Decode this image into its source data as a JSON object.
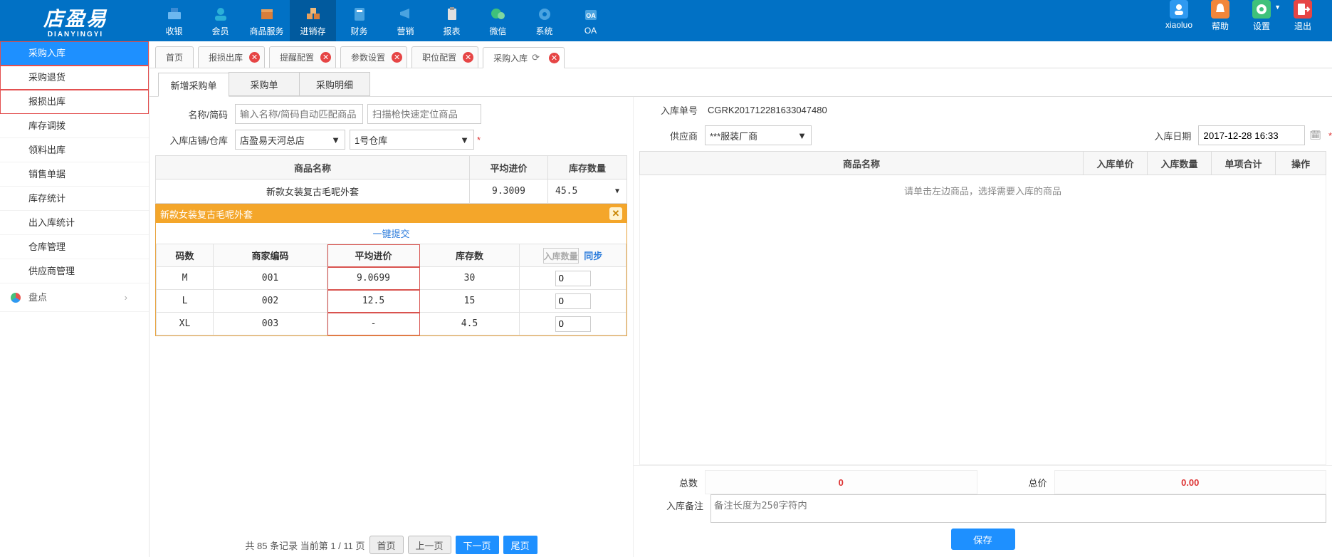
{
  "logo": {
    "main": "店盈易",
    "sub": "DIANYINGYI"
  },
  "topnav": {
    "items": [
      {
        "label": "收银",
        "icon": "cash-register"
      },
      {
        "label": "会员",
        "icon": "users"
      },
      {
        "label": "商品服务",
        "icon": "gift"
      },
      {
        "label": "进销存",
        "icon": "boxes",
        "active": true
      },
      {
        "label": "财务",
        "icon": "finance"
      },
      {
        "label": "营销",
        "icon": "megaphone"
      },
      {
        "label": "报表",
        "icon": "clipboard"
      },
      {
        "label": "微信",
        "icon": "wechat"
      },
      {
        "label": "系统",
        "icon": "gear"
      },
      {
        "label": "OA",
        "icon": "oa"
      }
    ],
    "right": [
      {
        "label": "xiaoluo",
        "icon": "user",
        "color": "#2f99f0"
      },
      {
        "label": "帮助",
        "icon": "bell",
        "color": "#f2863a"
      },
      {
        "label": "设置",
        "icon": "setting",
        "color": "#3fc17b",
        "arrow": true
      },
      {
        "label": "退出",
        "icon": "exit",
        "color": "#e64545"
      }
    ]
  },
  "sidebar": {
    "items": [
      {
        "label": "采购入库",
        "selected": true,
        "marked": true
      },
      {
        "label": "采购退货",
        "marked": true
      },
      {
        "label": "报损出库",
        "marked": true
      },
      {
        "label": "库存调拨"
      },
      {
        "label": "领料出库"
      },
      {
        "label": "销售单据"
      },
      {
        "label": "库存统计"
      },
      {
        "label": "出入库统计"
      },
      {
        "label": "仓库管理"
      },
      {
        "label": "供应商管理"
      }
    ],
    "section": {
      "label": "盘点",
      "caret": "›"
    }
  },
  "tabs": [
    {
      "label": "首页"
    },
    {
      "label": "报损出库",
      "closable": true
    },
    {
      "label": "提醒配置",
      "closable": true
    },
    {
      "label": "参数设置",
      "closable": true
    },
    {
      "label": "职位配置",
      "closable": true
    },
    {
      "label": "采购入库",
      "closable": true,
      "refresh": true,
      "active": true
    }
  ],
  "subtabs": [
    {
      "label": "新增采购单",
      "active": true
    },
    {
      "label": "采购单"
    },
    {
      "label": "采购明细"
    }
  ],
  "leftForm": {
    "name_label": "名称/简码",
    "name_placeholder": "输入名称/简码自动匹配商品",
    "scan_placeholder": "扫描枪快速定位商品",
    "shop_label": "入库店铺/仓库",
    "shop_value": "店盈易天河总店",
    "warehouse_value": "1号仓库"
  },
  "leftGrid": {
    "headers": {
      "name": "商品名称",
      "price": "平均进价",
      "qty": "库存数量"
    },
    "row": {
      "name": "新款女装复古毛呢外套",
      "price": "9.3009",
      "qty": "45.5"
    }
  },
  "popup": {
    "title": "新款女装复古毛呢外套",
    "quick_submit": "一键提交",
    "headers": {
      "size": "码数",
      "sku": "商家编码",
      "price": "平均进价",
      "stock": "库存数",
      "enter": "入库数量",
      "sync": "同步"
    },
    "rows": [
      {
        "size": "M",
        "sku": "001",
        "price": "9.0699",
        "stock": "30",
        "enter": "0"
      },
      {
        "size": "L",
        "sku": "002",
        "price": "12.5",
        "stock": "15",
        "enter": "0"
      },
      {
        "size": "XL",
        "sku": "003",
        "price": "-",
        "stock": "4.5",
        "enter": "0"
      }
    ]
  },
  "pager": {
    "summary": "共 85 条记录 当前第 1 / 11 页",
    "first": "首页",
    "prev": "上一页",
    "next": "下一页",
    "last": "尾页"
  },
  "rightForm": {
    "order_label": "入库单号",
    "order_value": "CGRK201712281633047480",
    "supplier_label": "供应商",
    "supplier_value": "***服装厂商",
    "date_label": "入库日期",
    "date_value": "2017-12-28 16:33"
  },
  "rightGrid": {
    "headers": {
      "name": "商品名称",
      "price": "入库单价",
      "qty": "入库数量",
      "total": "单项合计",
      "op": "操作"
    },
    "empty": "请单击左边商品，选择需要入库的商品"
  },
  "totals": {
    "qty_label": "总数",
    "qty_value": "0",
    "amt_label": "总价",
    "amt_value": "0.00"
  },
  "remark": {
    "label": "入库备注",
    "placeholder": "备注长度为250字符内"
  },
  "save": "保存"
}
